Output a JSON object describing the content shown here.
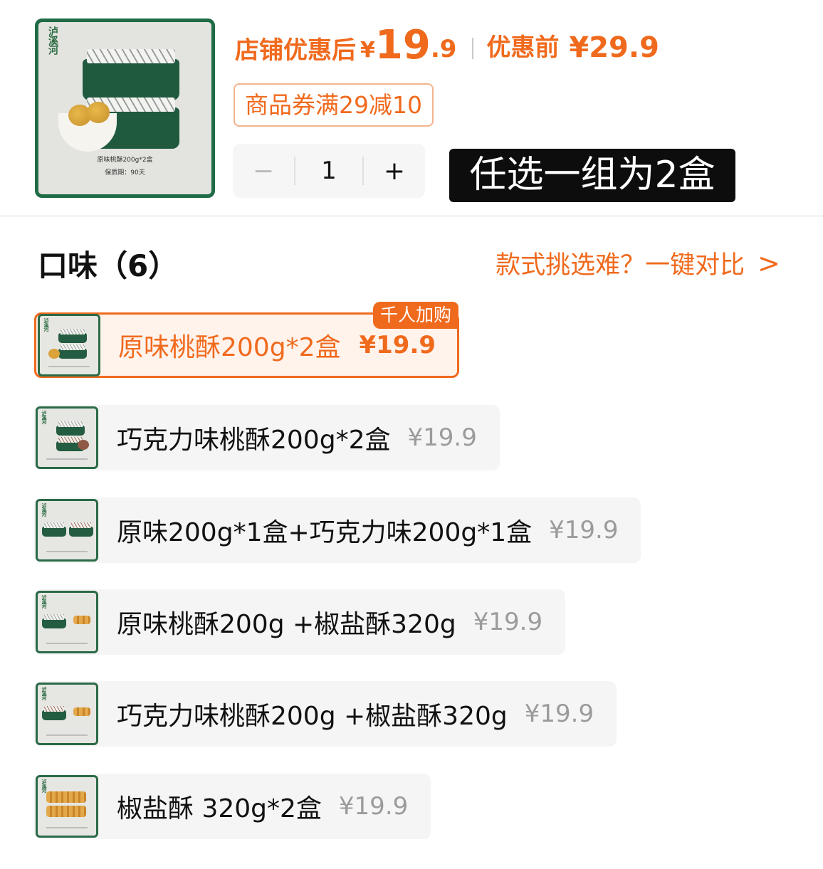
{
  "product": {
    "brand": "泸溪河",
    "image_caption": "原味桃酥200g*2盒",
    "image_shelf_life": "保质期：90天"
  },
  "pricing": {
    "after_label": "店铺优惠后",
    "currency": "¥",
    "after_int": "19",
    "after_dec": ".9",
    "before_label": "优惠前",
    "before_price": "¥29.9"
  },
  "coupon": {
    "text": "商品券满29减10"
  },
  "quantity": {
    "minus": "−",
    "value": "1",
    "plus": "+"
  },
  "tooltip": {
    "text": "任选一组为2盒"
  },
  "flavor": {
    "title": "口味（6）",
    "compare_text": "款式挑选难？一键对比",
    "compare_chevron": ">",
    "options": [
      {
        "name": "原味桃酥200g*2盒",
        "price": "¥19.9",
        "badge": "千人加购",
        "selected": true
      },
      {
        "name": "巧克力味桃酥200g*2盒",
        "price": "¥19.9"
      },
      {
        "name": "原味200g*1盒+巧克力味200g*1盒",
        "price": "¥19.9"
      },
      {
        "name": "原味桃酥200g +椒盐酥320g",
        "price": "¥19.9"
      },
      {
        "name": "巧克力味桃酥200g +椒盐酥320g",
        "price": "¥19.9"
      },
      {
        "name": "椒盐酥 320g*2盒",
        "price": "¥19.9"
      }
    ]
  },
  "colors": {
    "accent": "#f06a1d",
    "brand_green": "#1f6b45",
    "muted_price": "#9b9b9b",
    "chip_bg": "#f5f5f5"
  }
}
